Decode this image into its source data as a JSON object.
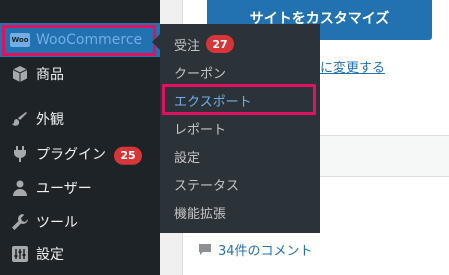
{
  "sidebar": {
    "items": [
      {
        "label": "WooCommerce",
        "icon": "woocommerce-icon",
        "icon_text": "Woo"
      },
      {
        "label": "商品",
        "icon": "products-box-icon"
      },
      {
        "label": "外観",
        "icon": "appearance-brush-icon"
      },
      {
        "label": "プラグイン",
        "icon": "plugins-icon",
        "badge": "25"
      },
      {
        "label": "ユーザー",
        "icon": "users-icon"
      },
      {
        "label": "ツール",
        "icon": "tools-wrench-icon"
      },
      {
        "label": "設定",
        "icon": "settings-sliders-icon"
      }
    ]
  },
  "submenu": {
    "items": [
      {
        "label": "受注",
        "badge": "27"
      },
      {
        "label": "クーポン"
      },
      {
        "label": "エクスポート"
      },
      {
        "label": "レポート"
      },
      {
        "label": "設定"
      },
      {
        "label": "ステータス"
      },
      {
        "label": "機能拡張"
      }
    ]
  },
  "content": {
    "customize_button": "サイトをカスタマイズ",
    "theme_link": "に変更する",
    "comments_link": "34件のコメント"
  },
  "colors": {
    "sidebar_bg": "#1d2327",
    "submenu_bg": "#2c3338",
    "accent": "#2271b1",
    "active_text": "#72aee6",
    "badge": "#d63638",
    "highlight": "#e0115f"
  }
}
